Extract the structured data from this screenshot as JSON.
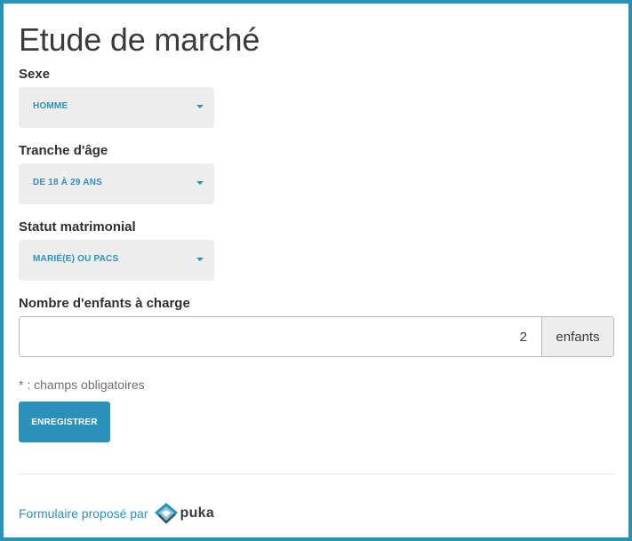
{
  "form": {
    "title": "Etude de marché",
    "fields": {
      "sexe": {
        "label": "Sexe",
        "value": "HOMME"
      },
      "age": {
        "label": "Tranche d'âge",
        "value": "DE 18 À 29 ANS"
      },
      "statut": {
        "label": "Statut matrimonial",
        "value": "MARIÉ(E) OU PACS"
      },
      "enfants": {
        "label": "Nombre d'enfants à charge",
        "value": "2",
        "unit": "enfants"
      }
    },
    "required_note": "* : champs obligatoires",
    "submit_label": "ENREGISTRER"
  },
  "footer": {
    "credit": "Formulaire proposé par",
    "logo_text": "puka"
  },
  "colors": {
    "accent": "#2a91b9",
    "field_background": "#ededed",
    "text": "#3b3b3b"
  },
  "icons": {
    "select_caret": "caret-down-icon",
    "logo": "puka-logo-icon"
  }
}
